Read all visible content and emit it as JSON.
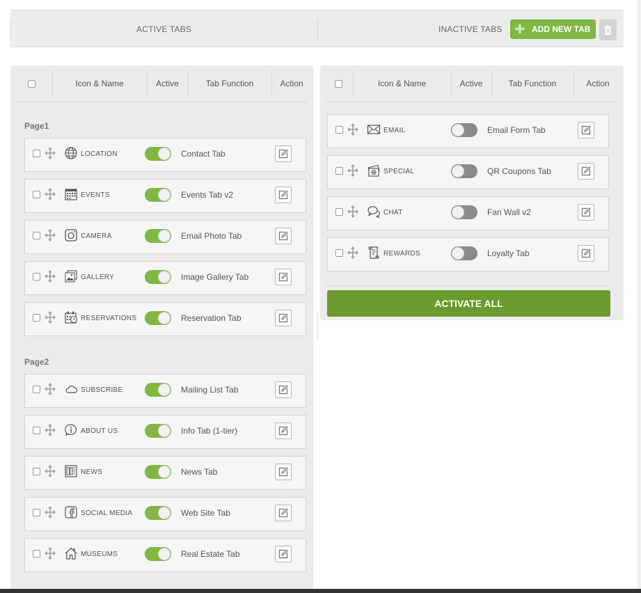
{
  "top": {
    "active_label": "ACTIVE TABS",
    "inactive_label": "INACTIVE TABS",
    "add_button": "ADD NEW TAB"
  },
  "columns": {
    "icon_name": "Icon & Name",
    "active": "Active",
    "tab_function": "Tab Function",
    "action": "Action"
  },
  "active": {
    "pages": [
      {
        "label": "Page1",
        "rows": [
          {
            "name": "LOCATION",
            "icon": "globe-icon",
            "function": "Contact Tab",
            "on": true
          },
          {
            "name": "EVENTS",
            "icon": "calendar-icon",
            "function": "Events Tab v2",
            "on": true
          },
          {
            "name": "CAMERA",
            "icon": "camera-icon",
            "function": "Email Photo Tab",
            "on": true
          },
          {
            "name": "GALLERY",
            "icon": "gallery-icon",
            "function": "Image Gallery Tab",
            "on": true
          },
          {
            "name": "RESERVATIONS",
            "icon": "reservation-icon",
            "function": "Reservation Tab",
            "on": true
          }
        ]
      },
      {
        "label": "Page2",
        "rows": [
          {
            "name": "SUBSCRIBE",
            "icon": "cloud-icon",
            "function": "Mailing List Tab",
            "on": true
          },
          {
            "name": "ABOUT US",
            "icon": "info-icon",
            "function": "Info Tab (1-tier)",
            "on": true
          },
          {
            "name": "NEWS",
            "icon": "news-icon",
            "function": "News Tab",
            "on": true
          },
          {
            "name": "SOCIAL MEDIA",
            "icon": "facebook-icon",
            "function": "Web Site Tab",
            "on": true
          },
          {
            "name": "MUSEUMS",
            "icon": "house-icon",
            "function": "Real Estate Tab",
            "on": true
          }
        ]
      }
    ]
  },
  "inactive": {
    "rows": [
      {
        "name": "EMAIL",
        "icon": "envelope-icon",
        "function": "Email Form Tab",
        "on": false
      },
      {
        "name": "SPECIAL",
        "icon": "coupon-icon",
        "function": "QR Coupons Tab",
        "on": false
      },
      {
        "name": "CHAT",
        "icon": "chat-icon",
        "function": "Fan Wall v2",
        "on": false
      },
      {
        "name": "REWARDS",
        "icon": "scroll-icon",
        "function": "Loyalty Tab",
        "on": false
      }
    ],
    "activate_all": "ACTIVATE ALL"
  },
  "colors": {
    "accent_green": "#7fb842",
    "activate_green": "#6b9b2e",
    "toggle_off": "#8a8a8a",
    "panel_bg": "#ebebeb"
  }
}
